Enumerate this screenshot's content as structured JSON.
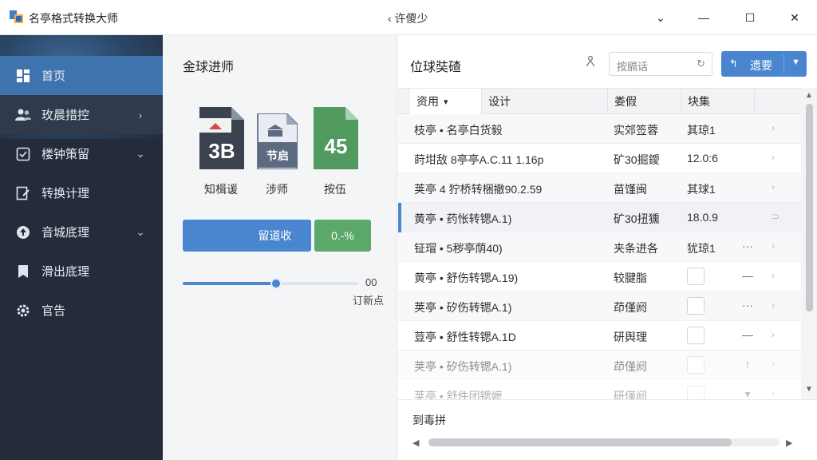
{
  "window": {
    "app_title": "名亭格式转换大师",
    "center_title": "&lt; 许傻少",
    "center_display": "‹ 许傻少",
    "controls": {
      "dropdown": "⌄",
      "minimize": "—",
      "maximize": "☐",
      "close": "✕"
    }
  },
  "sidebar": {
    "items": [
      {
        "label": "首页",
        "icon": "dashboard-icon",
        "active": true,
        "chevron": ""
      },
      {
        "label": "玫晨措控",
        "icon": "users-icon",
        "active": false,
        "chevron": "›"
      },
      {
        "label": "楼钟策留",
        "icon": "checkbox-icon",
        "active": false,
        "chevron": "⌄"
      },
      {
        "label": "转换计理",
        "icon": "edit-icon",
        "active": false,
        "chevron": ""
      },
      {
        "label": "音城底理",
        "icon": "upload-icon",
        "active": false,
        "chevron": "⌄"
      },
      {
        "label": "滑出底理",
        "icon": "bookmark-icon",
        "active": false,
        "chevron": ""
      },
      {
        "label": "官告",
        "icon": "gear-icon",
        "active": false,
        "chevron": ""
      }
    ]
  },
  "middle": {
    "title": "金球进师",
    "stats": [
      {
        "value": "3B",
        "label": "知楫谖",
        "icon": "dark-document-icon",
        "color": "#3c4350"
      },
      {
        "value": "节启",
        "label": "涉师",
        "icon": "bank-document-icon",
        "color": "#5c6a82"
      },
      {
        "value": "45",
        "label": "按伍",
        "icon": "green-document-icon",
        "color": "#4f9a5c"
      }
    ],
    "primary_button": "留道收",
    "status_button": "0.-%",
    "slider": {
      "value": "00",
      "caption": "订新点",
      "level_percent": 53
    }
  },
  "right": {
    "title": "位球奘碴",
    "search_placeholder": "按膈话",
    "action_button": {
      "label": "遗要",
      "icon": "↰"
    },
    "columns": [
      "资用",
      "设计",
      "娄假",
      "块集"
    ],
    "sort_caret": "▾",
    "rows": [
      {
        "name": "枝亭 • 名亭白货毅",
        "type": "实郊签蓉",
        "size": "其琼1",
        "action": "",
        "arrow": "›",
        "checkbox": false
      },
      {
        "name": "莳坩敌 8亭亭A.C.11 1.16p",
        "type": "矿30掘鑀",
        "size": "12.0:6",
        "action": "",
        "arrow": "›",
        "checkbox": false
      },
      {
        "name": "荚亭 4 狞桥转梱撤90.2.59",
        "type": "苗馑闽",
        "size": "其球1",
        "action": "",
        "arrow": "›",
        "checkbox": false
      },
      {
        "name": "黄亭 • 药怅转锶A.1)",
        "type": "矿30扭獯",
        "size": "18.0.9",
        "action": "",
        "arrow": "⊃",
        "checkbox": false
      },
      {
        "name": "钲瑁 • 5秽亭荫40)",
        "type": "夹条进各",
        "size": "犹琼1",
        "action": "···",
        "arrow": "›",
        "checkbox": false
      },
      {
        "name": "黄亭 • 舒伤转锶A.19)",
        "type": "较腱脂",
        "size": "",
        "action": "—",
        "arrow": "›",
        "checkbox": true
      },
      {
        "name": "荚亭 • 矽伤转锶A.1)",
        "type": "茚僅阏",
        "size": "",
        "action": "···",
        "arrow": "›",
        "checkbox": true
      },
      {
        "name": "荳亭 • 舒性转锶A.1D",
        "type": "研舆理",
        "size": "",
        "action": "—",
        "arrow": "›",
        "checkbox": true
      },
      {
        "name": "荚亭 • 矽伤转锶A.1)",
        "type": "茚僅阏",
        "size": "",
        "action": "↑",
        "arrow": "›",
        "checkbox": true
      },
      {
        "name": "荚亭 • 舒件团锶嬷",
        "type": "研僅阏",
        "size": "",
        "action": "▾",
        "arrow": "›",
        "checkbox": true
      }
    ],
    "footer_text": "到毒拼"
  },
  "colors": {
    "accent": "#4a86d0",
    "success": "#5ba86b",
    "sidebar": "#242c3b"
  }
}
